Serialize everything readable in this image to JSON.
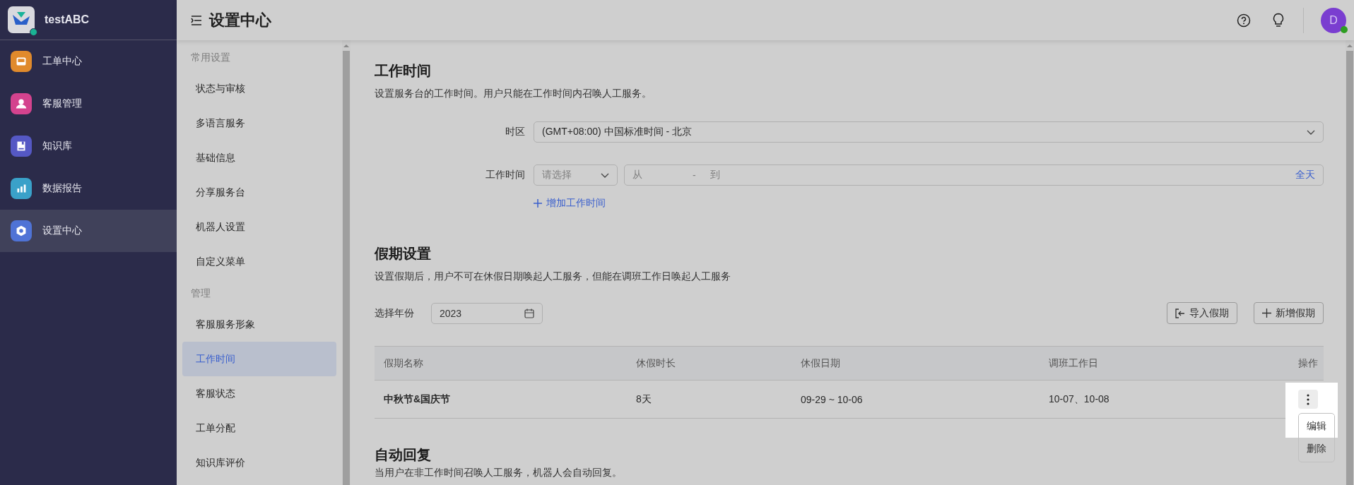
{
  "sidebar": {
    "brand": "testABC",
    "items": [
      {
        "label": "工单中心",
        "color": "#e08a2c",
        "selected": false
      },
      {
        "label": "客服管理",
        "color": "#d4438e",
        "selected": false
      },
      {
        "label": "知识库",
        "color": "#5558c4",
        "selected": false
      },
      {
        "label": "数据报告",
        "color": "#3aa1c9",
        "selected": false
      },
      {
        "label": "设置中心",
        "color": "#4f73d6",
        "selected": true
      }
    ]
  },
  "header": {
    "title": "设置中心",
    "avatar": "D",
    "online": true
  },
  "settings_nav": [
    {
      "group": "常用设置",
      "items": [
        {
          "label": "状态与审核",
          "selected": false
        },
        {
          "label": "多语言服务",
          "selected": false
        },
        {
          "label": "基础信息",
          "selected": false
        },
        {
          "label": "分享服务台",
          "selected": false
        },
        {
          "label": "机器人设置",
          "selected": false
        },
        {
          "label": "自定义菜单",
          "selected": false
        }
      ]
    },
    {
      "group": "管理",
      "items": [
        {
          "label": "客服服务形象",
          "selected": false
        },
        {
          "label": "工作时间",
          "selected": true
        },
        {
          "label": "客服状态",
          "selected": false
        },
        {
          "label": "工单分配",
          "selected": false
        },
        {
          "label": "知识库评价",
          "selected": false
        }
      ]
    }
  ],
  "working_hours": {
    "title": "工作时间",
    "description": "设置服务台的工作时间。用户只能在工作时间内召唤人工服务。",
    "timezone_label": "时区",
    "timezone": "(GMT+08:00) 中国标准时间 - 北京",
    "hours_label": "工作时间",
    "day_select": {
      "placeholder": "请选择"
    },
    "range": {
      "from": "从",
      "separator": "-",
      "to": "到",
      "all_day": "全天"
    },
    "add_link": "增加工作时间"
  },
  "holidays": {
    "title": "假期设置",
    "description": "设置假期后，用户不可在休假日期唤起人工服务，但能在调班工作日唤起人工服务",
    "year_label": "选择年份",
    "year": "2023",
    "buttons": [
      {
        "label": "导入假期",
        "kind": "import"
      },
      {
        "label": "新增假期",
        "kind": "add"
      }
    ],
    "table": {
      "columns": [
        "假期名称",
        "休假时长",
        "休假日期",
        "调班工作日",
        "操作"
      ],
      "rows": [
        {
          "name": "中秋节&国庆节",
          "duration": "8天",
          "dates": "09-29 ~ 10-06",
          "workdays": "10-07、10-08"
        }
      ]
    },
    "row_menu": {
      "items": [
        "编辑",
        "删除"
      ],
      "highlighted": true
    }
  },
  "auto_reply": {
    "title": "自动回复",
    "description": "当用户在非工作时间召唤人工服务，机器人会自动回复。"
  }
}
